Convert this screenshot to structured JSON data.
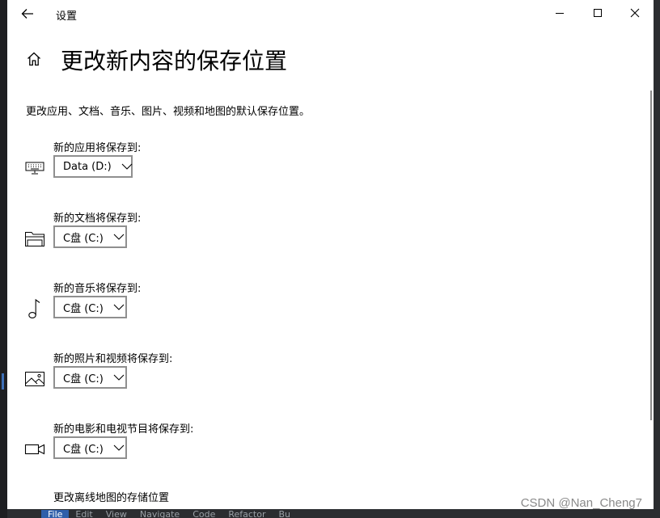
{
  "window": {
    "title": "设置",
    "back_icon": "back-arrow-icon",
    "minimize_icon": "minimize-icon",
    "maximize_icon": "maximize-icon",
    "close_icon": "close-icon"
  },
  "page": {
    "home_icon": "home-icon",
    "title": "更改新内容的保存位置",
    "description": "更改应用、文档、音乐、图片、视频和地图的默认保存位置。"
  },
  "locations": [
    {
      "label": "新的应用将保存到:",
      "icon": "keyboard-icon",
      "value": "Data (D:)"
    },
    {
      "label": "新的文档将保存到:",
      "icon": "folder-icon",
      "value": "C盘 (C:)"
    },
    {
      "label": "新的音乐将保存到:",
      "icon": "music-note-icon",
      "value": "C盘 (C:)"
    },
    {
      "label": "新的照片和视频将保存到:",
      "icon": "picture-icon",
      "value": "C盘 (C:)"
    },
    {
      "label": "新的电影和电视节目将保存到:",
      "icon": "video-camera-icon",
      "value": "C盘 (C:)"
    }
  ],
  "offline_maps_label": "更改离线地图的存储位置",
  "watermark": "CSDN @Nan_Cheng7",
  "background_menu": [
    "File",
    "Edit",
    "View",
    "Navigate",
    "Code",
    "Refactor",
    "Bu"
  ],
  "colors": {
    "window_bg": "#ffffff",
    "select_border": "#8f8f8f",
    "menu_active": "#2f5faa",
    "background_app": "#2b2d30"
  }
}
